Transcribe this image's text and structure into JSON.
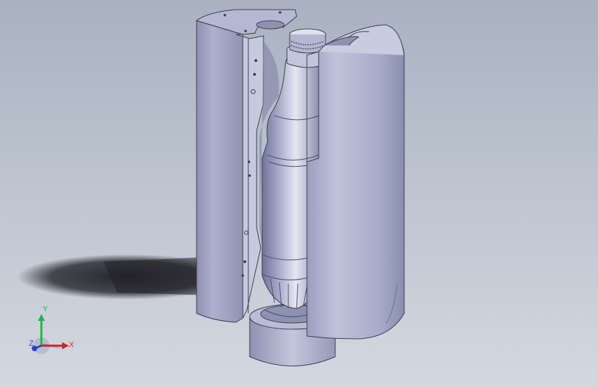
{
  "viewport": {
    "background_top": "#a9b2c0",
    "background_bottom": "#d3d8e0",
    "model_color": "#b3b6d2",
    "model_shade": "#7f83a6",
    "shadow_color": "#1c1d22"
  },
  "triad": {
    "x_label": "X",
    "y_label": "Y",
    "z_label": "Z",
    "x_color": "#d0202a",
    "y_color": "#22b24c",
    "z_color": "#2d3fd1"
  }
}
